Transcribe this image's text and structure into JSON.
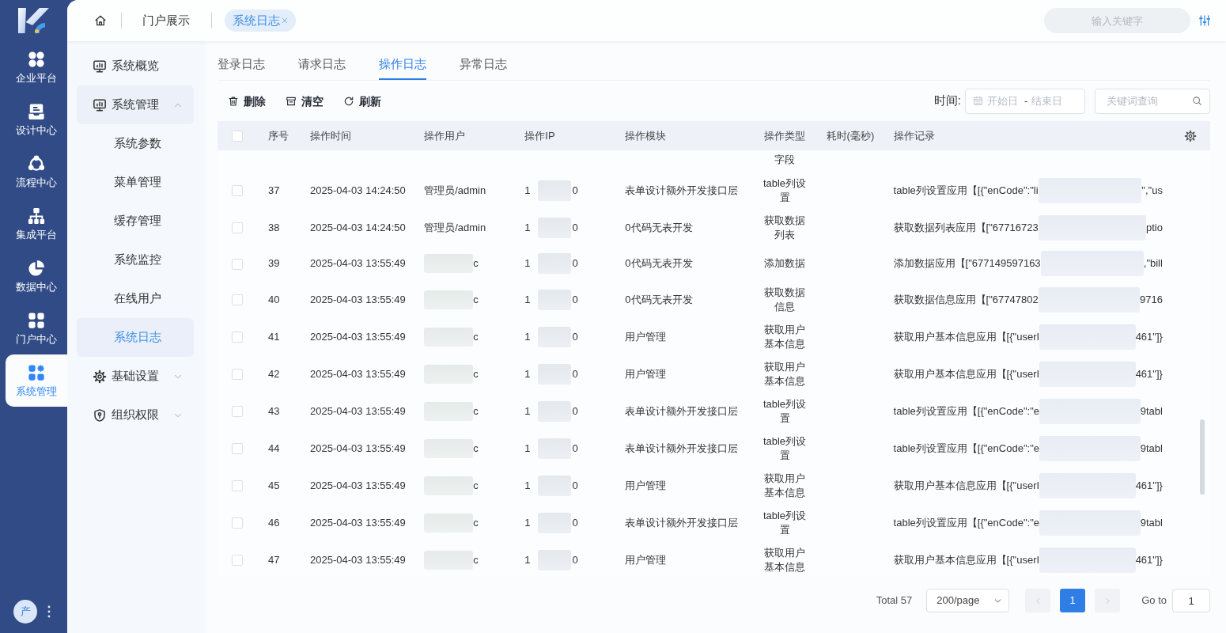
{
  "rail": {
    "items": [
      {
        "label": "企业平台",
        "selected": false
      },
      {
        "label": "设计中心",
        "selected": false
      },
      {
        "label": "流程中心",
        "selected": false
      },
      {
        "label": "集成平台",
        "selected": false
      },
      {
        "label": "数据中心",
        "selected": false
      },
      {
        "label": "门户中心",
        "selected": false
      },
      {
        "label": "系统管理",
        "selected": true
      }
    ],
    "avatar": "产"
  },
  "topbar": {
    "tabs": [
      {
        "label": "门户展示",
        "selected": false,
        "closable": false
      },
      {
        "label": "系统日志",
        "selected": true,
        "closable": true
      }
    ],
    "search": {
      "placeholder": "输入关键字"
    }
  },
  "sidebar": {
    "items": [
      {
        "label": "系统概览",
        "kind": "link",
        "selected": false
      },
      {
        "label": "系统管理",
        "kind": "group",
        "selected": false,
        "expanded": true,
        "children": [
          {
            "label": "系统参数",
            "selected": false
          },
          {
            "label": "菜单管理",
            "selected": false
          },
          {
            "label": "缓存管理",
            "selected": false
          },
          {
            "label": "系统监控",
            "selected": false
          },
          {
            "label": "在线用户",
            "selected": false
          },
          {
            "label": "系统日志",
            "selected": true
          }
        ]
      },
      {
        "label": "基础设置",
        "kind": "group",
        "selected": false,
        "expanded": false
      },
      {
        "label": "组织权限",
        "kind": "group",
        "selected": false,
        "expanded": false
      }
    ]
  },
  "log_tabs": [
    {
      "label": "登录日志",
      "selected": false
    },
    {
      "label": "请求日志",
      "selected": false
    },
    {
      "label": "操作日志",
      "selected": true
    },
    {
      "label": "异常日志",
      "selected": false
    }
  ],
  "toolbar": {
    "actions": [
      "删除",
      "清空",
      "刷新"
    ],
    "time_label": "时间:",
    "date_range": {
      "start_placeholder": "开始日",
      "separator": "-",
      "end_placeholder": "结束日"
    },
    "keyword": {
      "placeholder": "关键词查询"
    }
  },
  "table": {
    "header_checked": false,
    "columns": [
      "序号",
      "操作时间",
      "操作用户",
      "操作IP",
      "操作模块",
      "操作类型",
      "耗时(毫秒)",
      "操作记录"
    ],
    "rows": [
      {
        "kind": "partial",
        "type": "字段"
      },
      {
        "kind": "full",
        "checked": false,
        "no": "37",
        "time": "2025-04-03 14:24:50",
        "user": "管理员/admin",
        "user_blurred": false,
        "ip_head": "1",
        "ip_tail": "0",
        "module": "表单设计额外开发接口层",
        "type": "table列设置",
        "record_head": "table列设置应用【[{\"enCode\":\"li",
        "record_tail": "\",\"us"
      },
      {
        "kind": "full",
        "checked": false,
        "no": "38",
        "time": "2025-04-03 14:24:50",
        "user": "管理员/admin",
        "user_blurred": false,
        "ip_head": "1",
        "ip_tail": "0",
        "module": "0代码无表开发",
        "type": "获取数据列表",
        "record_head": "获取数据列表应用【[\"67716723",
        "record_tail": "ptio"
      },
      {
        "kind": "full",
        "checked": false,
        "no": "39",
        "time": "2025-04-03 13:55:49",
        "user": "c",
        "user_blurred": true,
        "ip_head": "1",
        "ip_tail": "0",
        "module": "0代码无表开发",
        "type": "添加数据",
        "record_head": "添加数据应用【[\"677149597163",
        "record_tail": ",\"bill"
      },
      {
        "kind": "full",
        "checked": false,
        "no": "40",
        "time": "2025-04-03 13:55:49",
        "user": "c",
        "user_blurred": true,
        "ip_head": "1",
        "ip_tail": "0",
        "module": "0代码无表开发",
        "type": "获取数据信息",
        "record_head": "获取数据信息应用【[\"67747802",
        "record_tail": "9716"
      },
      {
        "kind": "full",
        "checked": false,
        "no": "41",
        "time": "2025-04-03 13:55:49",
        "user": "c",
        "user_blurred": true,
        "ip_head": "1",
        "ip_tail": "0",
        "module": "用户管理",
        "type": "获取用户基本信息",
        "record_head": "获取用户基本信息应用【[{\"userI",
        "record_tail": "461\"]}"
      },
      {
        "kind": "full",
        "checked": false,
        "no": "42",
        "time": "2025-04-03 13:55:49",
        "user": "c",
        "user_blurred": true,
        "ip_head": "1",
        "ip_tail": "0",
        "module": "用户管理",
        "type": "获取用户基本信息",
        "record_head": "获取用户基本信息应用【[{\"userI",
        "record_tail": "461\"]}"
      },
      {
        "kind": "full",
        "checked": false,
        "no": "43",
        "time": "2025-04-03 13:55:49",
        "user": "c",
        "user_blurred": true,
        "ip_head": "1",
        "ip_tail": "0",
        "module": "表单设计额外开发接口层",
        "type": "table列设置",
        "record_head": "table列设置应用【[{\"enCode\":\"e",
        "record_tail": "9tabl"
      },
      {
        "kind": "full",
        "checked": false,
        "no": "44",
        "time": "2025-04-03 13:55:49",
        "user": "c",
        "user_blurred": true,
        "ip_head": "1",
        "ip_tail": "0",
        "module": "表单设计额外开发接口层",
        "type": "table列设置",
        "record_head": "table列设置应用【[{\"enCode\":\"e",
        "record_tail": "9tabl"
      },
      {
        "kind": "full",
        "checked": false,
        "no": "45",
        "time": "2025-04-03 13:55:49",
        "user": "c",
        "user_blurred": true,
        "ip_head": "1",
        "ip_tail": "0",
        "module": "用户管理",
        "type": "获取用户基本信息",
        "record_head": "获取用户基本信息应用【[{\"userI",
        "record_tail": "461\"]}"
      },
      {
        "kind": "full",
        "checked": false,
        "no": "46",
        "time": "2025-04-03 13:55:49",
        "user": "c",
        "user_blurred": true,
        "ip_head": "1",
        "ip_tail": "0",
        "module": "表单设计额外开发接口层",
        "type": "table列设置",
        "record_head": "table列设置应用【[{\"enCode\":\"e",
        "record_tail": "9tabl"
      },
      {
        "kind": "full",
        "checked": false,
        "no": "47",
        "time": "2025-04-03 13:55:49",
        "user": "c",
        "user_blurred": true,
        "ip_head": "1",
        "ip_tail": "0",
        "module": "用户管理",
        "type": "获取用户基本信息",
        "record_head": "获取用户基本信息应用【[{\"userI",
        "record_tail": "461\"]}"
      }
    ]
  },
  "pagination": {
    "total": "Total 57",
    "page_size": "200/page",
    "previous": {
      "disabled": true
    },
    "pages": [
      {
        "label": "1",
        "selected": true
      }
    ],
    "next": {
      "disabled": true
    },
    "goto_label": "Go to",
    "goto_value": "1"
  }
}
